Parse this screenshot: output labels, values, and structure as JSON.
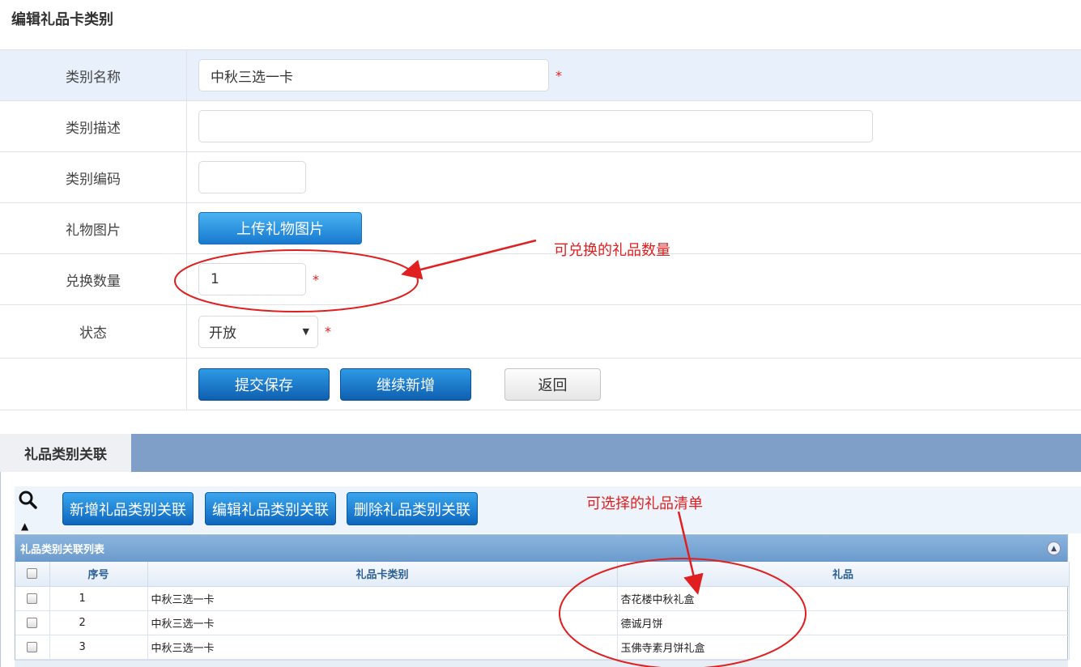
{
  "page": {
    "title": "编辑礼品卡类别"
  },
  "form": {
    "category_name": {
      "label": "类别名称",
      "value": "中秋三选一卡",
      "required": "*"
    },
    "category_desc": {
      "label": "类别描述",
      "value": ""
    },
    "category_code": {
      "label": "类别编码",
      "value": ""
    },
    "gift_image": {
      "label": "礼物图片",
      "button": "上传礼物图片"
    },
    "exchange_qty": {
      "label": "兑换数量",
      "value": "1",
      "required": "*"
    },
    "status": {
      "label": "状态",
      "value": "开放",
      "required": "*"
    },
    "actions": {
      "submit": "提交保存",
      "continue_add": "继续新增",
      "back": "返回"
    }
  },
  "annotations": {
    "qty_note": "可兑换的礼品数量",
    "list_note": "可选择的礼品清单",
    "color": "#e02020"
  },
  "association": {
    "tab_label": "礼品类别关联",
    "toolbar": {
      "add": "新增礼品类别关联",
      "edit": "编辑礼品类别关联",
      "delete": "删除礼品类别关联"
    },
    "grid": {
      "caption": "礼品类别关联列表",
      "columns": {
        "seq": "序号",
        "card_category": "礼品卡类别",
        "gift": "礼品"
      },
      "rows": [
        {
          "seq": "1",
          "card_category": "中秋三选一卡",
          "gift": "杏花楼中秋礼盒"
        },
        {
          "seq": "2",
          "card_category": "中秋三选一卡",
          "gift": "德诚月饼"
        },
        {
          "seq": "3",
          "card_category": "中秋三选一卡",
          "gift": "玉佛寺素月饼礼盒"
        }
      ]
    }
  },
  "colors": {
    "primary_button": "#1879cf",
    "section_bar": "#7f9fc9",
    "row_highlight": "#e8f1fb"
  }
}
